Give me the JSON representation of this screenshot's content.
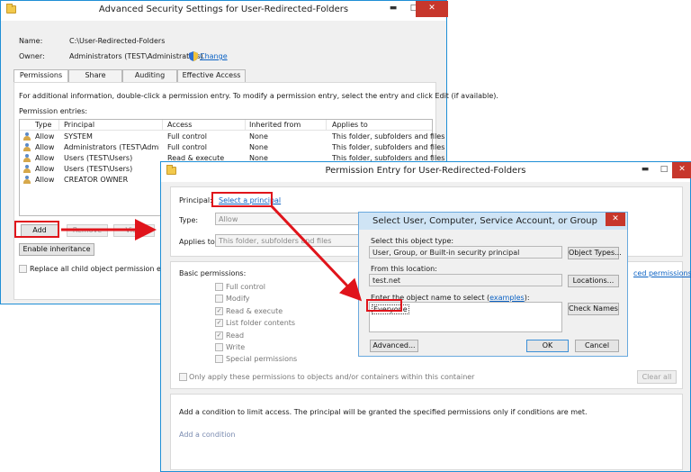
{
  "main_window": {
    "title": "Advanced Security Settings for User-Redirected-Folders",
    "name_label": "Name:",
    "name_value": "C:\\User-Redirected-Folders",
    "owner_label": "Owner:",
    "owner_value": "Administrators (TEST\\Administrators)",
    "change_link": "Change",
    "tabs": [
      "Permissions",
      "Share",
      "Auditing",
      "Effective Access"
    ],
    "info_text": "For additional information, double-click a permission entry. To modify a permission entry, select the entry and click Edit (if available).",
    "entries_label": "Permission entries:",
    "columns": [
      "Type",
      "Principal",
      "Access",
      "Inherited from",
      "Applies to"
    ],
    "rows": [
      {
        "type": "Allow",
        "principal": "SYSTEM",
        "access": "Full control",
        "inherited": "None",
        "applies": "This folder, subfolders and files"
      },
      {
        "type": "Allow",
        "principal": "Administrators (TEST\\Admini...",
        "access": "Full control",
        "inherited": "None",
        "applies": "This folder, subfolders and files"
      },
      {
        "type": "Allow",
        "principal": "Users (TEST\\Users)",
        "access": "Read & execute",
        "inherited": "None",
        "applies": "This folder, subfolders and files"
      },
      {
        "type": "Allow",
        "principal": "Users (TEST\\Users)",
        "access": "",
        "inherited": "",
        "applies": ""
      },
      {
        "type": "Allow",
        "principal": "CREATOR OWNER",
        "access": "",
        "inherited": "",
        "applies": ""
      }
    ],
    "add_button": "Add",
    "remove_button": "Remove",
    "view_button": "View",
    "enable_inheritance_button": "Enable inheritance",
    "replace_checkbox_label": "Replace all child object permission entries wi"
  },
  "entry_window": {
    "title": "Permission Entry for User-Redirected-Folders",
    "principal_label": "Principal:",
    "select_principal_link": "Select a principal",
    "type_label": "Type:",
    "type_value": "Allow",
    "applies_label": "Applies to:",
    "applies_value": "This folder, subfolders and files",
    "basic_permissions_label": "Basic permissions:",
    "advanced_permissions_link": "ced permissions",
    "permissions": [
      {
        "label": "Full control",
        "checked": false
      },
      {
        "label": "Modify",
        "checked": false
      },
      {
        "label": "Read & execute",
        "checked": true
      },
      {
        "label": "List folder contents",
        "checked": true
      },
      {
        "label": "Read",
        "checked": true
      },
      {
        "label": "Write",
        "checked": false
      },
      {
        "label": "Special permissions",
        "checked": false
      }
    ],
    "only_apply_label": "Only apply these permissions to objects and/or containers within this container",
    "clear_all_button": "Clear all",
    "condition_text": "Add a condition to limit access. The principal will be granted the specified permissions only if conditions are met.",
    "add_condition_link": "Add a condition"
  },
  "select_dialog": {
    "title": "Select User, Computer, Service Account, or Group",
    "object_type_label": "Select this object type:",
    "object_type_value": "User, Group, or Built-in security principal",
    "object_types_button": "Object Types...",
    "location_label": "From this location:",
    "location_value": "test.net",
    "locations_button": "Locations...",
    "enter_name_label_prefix": "Enter the object name to select (",
    "examples_link": "examples",
    "enter_name_label_suffix": "):",
    "name_input_value": "Everyone",
    "check_names_button": "Check Names",
    "advanced_button": "Advanced...",
    "ok_button": "OK",
    "cancel_button": "Cancel"
  },
  "icons": {
    "window": "folder-icon",
    "change": "shield-icon",
    "principal_row": "user-group-icon",
    "minimize": "minimize-icon",
    "maximize": "maximize-icon",
    "close": "close-icon"
  },
  "symbols": {
    "check": "✓",
    "minimize": "▬",
    "maximize": "□",
    "close": "✕"
  },
  "colors": {
    "accent": "#1f8fd6",
    "annotation": "#e0141b",
    "link": "#0b62c4",
    "close": "#c7372c"
  }
}
